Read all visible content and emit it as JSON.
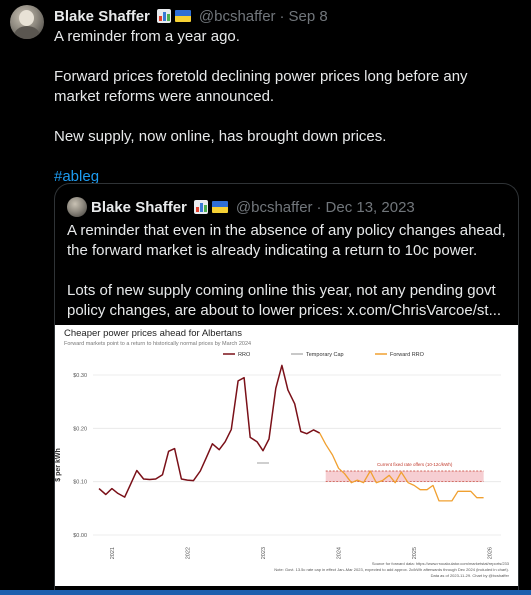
{
  "post": {
    "author_name": "Blake Shaffer",
    "handle": "@bcshaffer",
    "separator": "·",
    "date": "Sep 8",
    "lines": [
      "A reminder from a year ago.",
      "Forward prices foretold declining power prices long before any market reforms were announced.",
      "New supply, now online, has brought down prices."
    ],
    "hashtag": "#ableg"
  },
  "quote": {
    "author_name": "Blake Shaffer",
    "handle": "@bcshaffer",
    "separator": "·",
    "date": "Dec 13, 2023",
    "paragraph1": "A reminder that even in the absence of any policy changes ahead, the forward market is already indicating a return to 10c power.",
    "paragraph2": "Lots of new supply coming online this year, not any pending govt policy changes, are about to lower prices:",
    "link": "x.com/ChrisVarcoe/st..."
  },
  "chart_data": {
    "type": "line",
    "title": "Cheaper power prices ahead for Albertans",
    "subtitle": "Forward markets point to a return to historically normal prices by March 2024",
    "ylabel": "$ per kWh",
    "ylim": [
      0,
      0.3
    ],
    "yticks": [
      "$0.00",
      "$0.10",
      "$0.20",
      "$0.30"
    ],
    "xlim": [
      2020.75,
      2026.15
    ],
    "xticks": [
      "2021",
      "2022",
      "2023",
      "2024",
      "2025",
      "2026"
    ],
    "legend_position": "top",
    "series": [
      {
        "name": "RRO",
        "color": "#7a1018",
        "x": [
          2020.83,
          2020.92,
          2021.0,
          2021.08,
          2021.17,
          2021.25,
          2021.33,
          2021.42,
          2021.5,
          2021.58,
          2021.67,
          2021.75,
          2021.83,
          2021.92,
          2022.0,
          2022.08,
          2022.17,
          2022.25,
          2022.33,
          2022.42,
          2022.5,
          2022.58,
          2022.67,
          2022.75,
          2022.83,
          2022.92,
          2023.0,
          2023.08,
          2023.17,
          2023.25,
          2023.33,
          2023.42,
          2023.5,
          2023.58,
          2023.67,
          2023.75
        ],
        "values": [
          0.087,
          0.076,
          0.087,
          0.078,
          0.071,
          0.096,
          0.121,
          0.105,
          0.104,
          0.105,
          0.113,
          0.157,
          0.162,
          0.105,
          0.103,
          0.102,
          0.12,
          0.145,
          0.171,
          0.16,
          0.175,
          0.198,
          0.289,
          0.295,
          0.183,
          0.175,
          0.158,
          0.18,
          0.275,
          0.318,
          0.272,
          0.246,
          0.194,
          0.19,
          0.197,
          0.191
        ]
      },
      {
        "name": "Temporary Cap",
        "color": "#b5b5b5",
        "x": [
          2022.92,
          2023.08
        ],
        "values": [
          0.135,
          0.135
        ]
      },
      {
        "name": "Forward RRO",
        "color": "#f0a030",
        "x": [
          2023.75,
          2023.83,
          2023.92,
          2024.0,
          2024.08,
          2024.17,
          2024.25,
          2024.33,
          2024.42,
          2024.5,
          2024.58,
          2024.67,
          2024.75,
          2024.83,
          2024.92,
          2025.0,
          2025.08,
          2025.17,
          2025.25,
          2025.33,
          2025.42,
          2025.5,
          2025.58,
          2025.67,
          2025.75,
          2025.83,
          2025.92
        ],
        "values": [
          0.191,
          0.17,
          0.15,
          0.125,
          0.115,
          0.098,
          0.103,
          0.098,
          0.12,
          0.098,
          0.102,
          0.112,
          0.098,
          0.118,
          0.098,
          0.093,
          0.085,
          0.085,
          0.093,
          0.064,
          0.064,
          0.064,
          0.082,
          0.082,
          0.082,
          0.07,
          0.07
        ]
      }
    ],
    "annotation": {
      "label": "Current fixed rate offers (10-12c/kWh)",
      "band": [
        0.1,
        0.12
      ],
      "x_range": [
        2023.83,
        2025.92
      ]
    },
    "notes": [
      "Source for forward data: https://www.rrocalculator.com/marketstat/reports/233",
      "Note: Govt. 13.5c rate cap in effect Jan–Mar 2023, expected to add approx. 2c/kWh afterwards through Dec 2024 (included in chart).",
      "Data as of 2023-11-29. Chart by @bcshaffer"
    ]
  }
}
